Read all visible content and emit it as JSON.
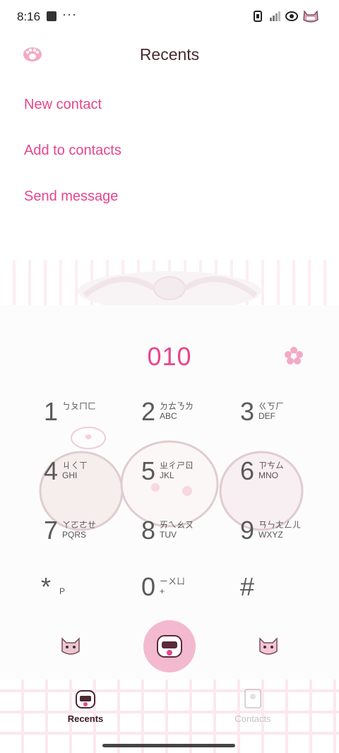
{
  "status": {
    "time": "8:16",
    "dots": "···"
  },
  "header": {
    "title": "Recents"
  },
  "menu": [
    {
      "label": "New contact"
    },
    {
      "label": "Add to contacts"
    },
    {
      "label": "Send message"
    }
  ],
  "dialer": {
    "number": "010",
    "keys": [
      {
        "digit": "1",
        "sub1": "ㄅㄆㄇㄈ",
        "sub2": ""
      },
      {
        "digit": "2",
        "sub1": "ㄉㄊㄋㄌ",
        "sub2": "ABC"
      },
      {
        "digit": "3",
        "sub1": "ㄍㄎㄏ",
        "sub2": "DEF"
      },
      {
        "digit": "4",
        "sub1": "ㄐㄑㄒ",
        "sub2": "GHI"
      },
      {
        "digit": "5",
        "sub1": "ㄓㄔㄕㄖ",
        "sub2": "JKL"
      },
      {
        "digit": "6",
        "sub1": "ㄗㄘㄙ",
        "sub2": "MNO"
      },
      {
        "digit": "7",
        "sub1": "ㄚㄛㄜㄝ",
        "sub2": "PQRS"
      },
      {
        "digit": "8",
        "sub1": "ㄞㄟㄠㄡ",
        "sub2": "TUV"
      },
      {
        "digit": "9",
        "sub1": "ㄢㄣㄤㄥㄦ",
        "sub2": "WXYZ"
      },
      {
        "digit": "*",
        "sub1": "",
        "sub2": "P"
      },
      {
        "digit": "0",
        "sub1": "ㄧㄨㄩ",
        "sub2": "+"
      },
      {
        "digit": "#",
        "sub1": "",
        "sub2": ""
      }
    ]
  },
  "nav": {
    "recents": "Recents",
    "contacts": "Contacts"
  },
  "colors": {
    "accent": "#e8458d",
    "call": "#f3b9cf"
  },
  "icons": {
    "paw": "paw-icon",
    "flower": "flower-icon",
    "call": "call-cat-icon"
  }
}
